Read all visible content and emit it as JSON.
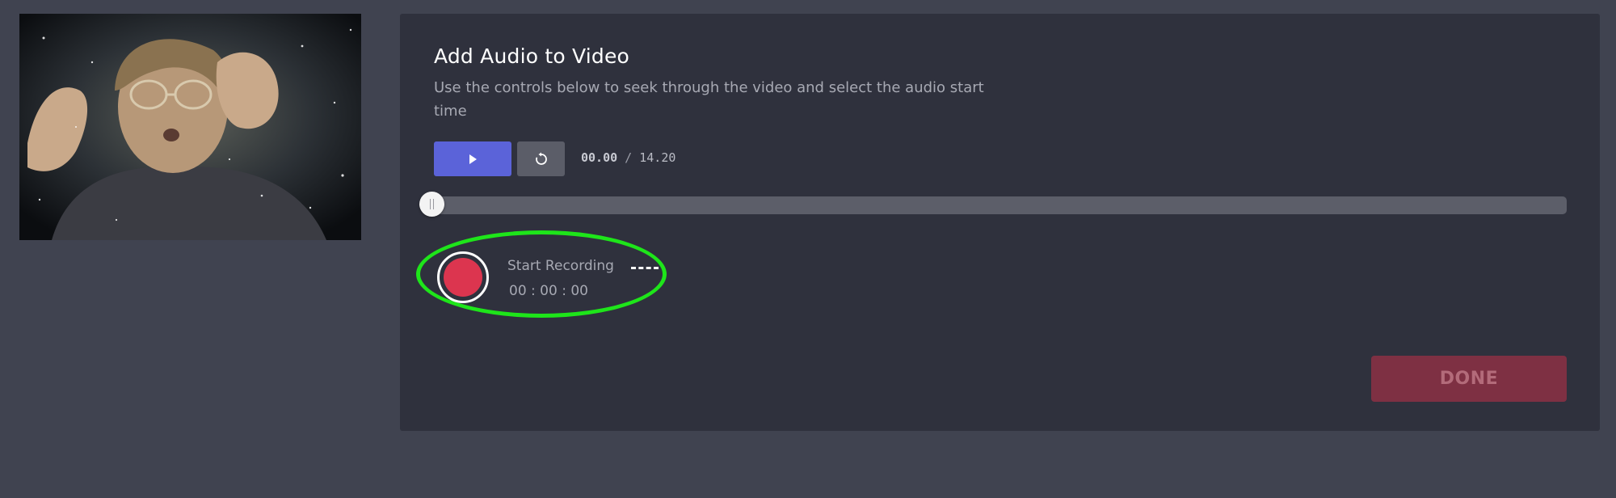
{
  "video_thumbnail": {
    "alt": "video preview frame"
  },
  "panel": {
    "title": "Add Audio to Video",
    "subtitle": "Use the controls below to seek through the video and select the audio start time"
  },
  "controls": {
    "play_icon": "play-icon",
    "reset_icon": "replay-icon",
    "current_time": "00.00",
    "separator": " / ",
    "duration": "14.20"
  },
  "seek": {
    "position_fraction": 0.0
  },
  "recording": {
    "label": "Start Recording",
    "timer": "00 : 00 : 00",
    "highlight_color": "#1ee51a",
    "record_color": "#dc354f"
  },
  "done_button": {
    "label": "DONE"
  },
  "colors": {
    "background": "#404350",
    "panel": "#2f313d",
    "accent": "#5b63d9"
  }
}
